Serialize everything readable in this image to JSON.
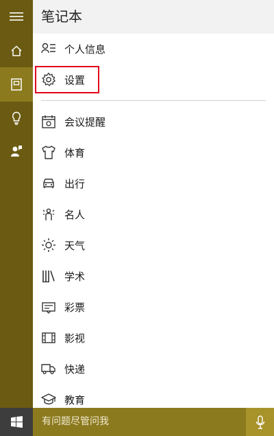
{
  "header": {
    "title": "笔记本"
  },
  "rail": {
    "items": [
      {
        "name": "menu-icon"
      },
      {
        "name": "home-icon"
      },
      {
        "name": "notebook-icon"
      },
      {
        "name": "lightbulb-icon"
      },
      {
        "name": "feedback-icon"
      }
    ]
  },
  "menu": {
    "items": [
      {
        "label": "个人信息",
        "icon": "person-list-icon"
      },
      {
        "label": "设置",
        "icon": "gear-icon",
        "highlighted": true
      },
      {
        "label": "会议提醒",
        "icon": "calendar-icon"
      },
      {
        "label": "体育",
        "icon": "jersey-icon"
      },
      {
        "label": "出行",
        "icon": "car-icon"
      },
      {
        "label": "名人",
        "icon": "celebrity-icon"
      },
      {
        "label": "天气",
        "icon": "sun-icon"
      },
      {
        "label": "学术",
        "icon": "books-icon"
      },
      {
        "label": "彩票",
        "icon": "ticket-icon"
      },
      {
        "label": "影视",
        "icon": "film-icon"
      },
      {
        "label": "快递",
        "icon": "truck-icon"
      },
      {
        "label": "教育",
        "icon": "graduation-cap-icon"
      }
    ]
  },
  "taskbar": {
    "search_text": "有问题尽管问我",
    "start_icon": "windows-logo-icon",
    "mic_icon": "microphone-icon"
  },
  "colors": {
    "rail": "#6b5b12",
    "rail_active": "#8c7a1e",
    "taskbar": "#8c7a1e",
    "highlight_border": "#e0001a"
  }
}
